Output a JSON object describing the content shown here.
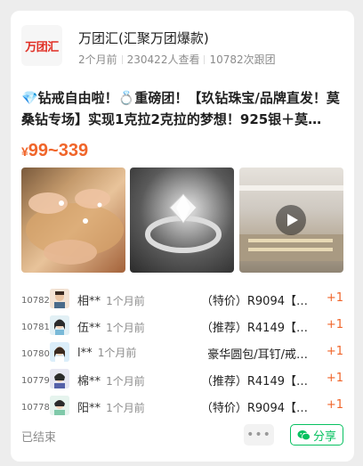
{
  "group": {
    "logo_text": "万团汇",
    "name": "万团汇(汇聚万团爆款)",
    "posted": "2个月前",
    "views": "230422人查看",
    "follows": "10782次跟团"
  },
  "product": {
    "title": "💎钻戒自由啦！💍重磅团！【玖钻珠宝/品牌直发！莫桑钻专场】实现1克拉2克拉的梦想！925银＋莫…",
    "currency": "¥",
    "price": "99~339"
  },
  "images": [
    {
      "icon": "hands-with-rings-photo"
    },
    {
      "icon": "diamond-ring-photo"
    },
    {
      "icon": "jewelry-store-video",
      "has_play": true
    }
  ],
  "orders": [
    {
      "no": "10782",
      "name": "相**",
      "time": "1个月前",
      "item": "（特价）R9094【…",
      "qty": "+1"
    },
    {
      "no": "10781",
      "name": "伍**",
      "time": "1个月前",
      "item": "（推荐）R4149【…",
      "qty": "+1"
    },
    {
      "no": "10780",
      "name": "l**",
      "time": "1个月前",
      "item": "豪华圆包/耳钉/戒…",
      "qty": "+1"
    },
    {
      "no": "10779",
      "name": "棉**",
      "time": "1个月前",
      "item": "（推荐）R4149【…",
      "qty": "+1"
    },
    {
      "no": "10778",
      "name": "阳**",
      "time": "1个月前",
      "item": "（特价）R9094【…",
      "qty": "+1"
    }
  ],
  "footer": {
    "status": "已结束",
    "more": "•••",
    "share": "分享"
  },
  "colors": {
    "accent": "#f0652a",
    "share": "#07c160",
    "logo": "#e02e24"
  }
}
